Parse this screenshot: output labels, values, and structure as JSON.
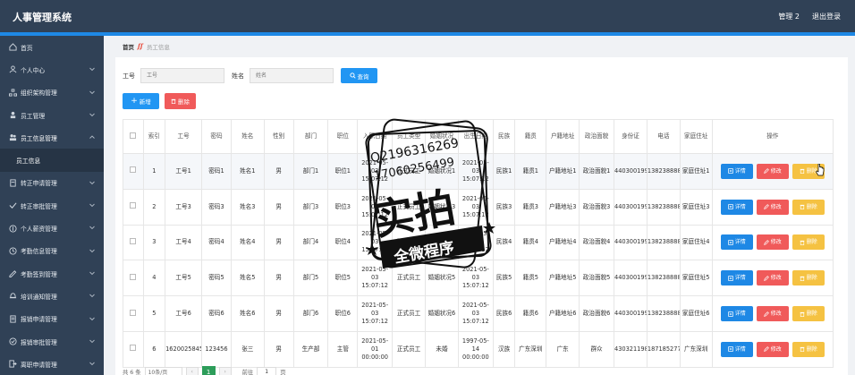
{
  "header": {
    "title": "人事管理系统",
    "user": "管理 2",
    "logout": "退出登录"
  },
  "sidebar": {
    "items": [
      {
        "label": "首页",
        "icon": "home-icon",
        "chevron": false
      },
      {
        "label": "个人中心",
        "icon": "person-icon",
        "chevron": true
      },
      {
        "label": "组织架构管理",
        "icon": "org-icon",
        "chevron": true
      },
      {
        "label": "员工管理",
        "icon": "user-icon",
        "chevron": true
      },
      {
        "label": "员工信息管理",
        "icon": "users-icon",
        "chevron": true,
        "open": true
      },
      {
        "label": "员工信息",
        "sub": true
      },
      {
        "label": "转正申请管理",
        "icon": "doc-icon",
        "chevron": true
      },
      {
        "label": "转正审批管理",
        "icon": "check-icon",
        "chevron": true
      },
      {
        "label": "个人薪资管理",
        "icon": "money-icon",
        "chevron": true
      },
      {
        "label": "考勤信息管理",
        "icon": "clock-icon",
        "chevron": true
      },
      {
        "label": "考勤签到管理",
        "icon": "sign-icon",
        "chevron": true
      },
      {
        "label": "培训通知管理",
        "icon": "bell-icon",
        "chevron": true
      },
      {
        "label": "报销申请管理",
        "icon": "receipt-icon",
        "chevron": true
      },
      {
        "label": "报销审批管理",
        "icon": "approve-icon",
        "chevron": true
      },
      {
        "label": "离职申请管理",
        "icon": "exit-icon",
        "chevron": true
      }
    ]
  },
  "breadcrumb": {
    "home": "首页",
    "sep": "ʃʃ",
    "current": "员工信息"
  },
  "search": {
    "gonghao_label": "工号",
    "gonghao_placeholder": "工号",
    "xingming_label": "姓名",
    "xingming_placeholder": "姓名",
    "query_label": "查询"
  },
  "toolbar": {
    "add_label": "新增",
    "delete_label": "删除"
  },
  "table": {
    "headers": [
      "",
      "索引",
      "工号",
      "密码",
      "姓名",
      "性别",
      "部门",
      "职位",
      "入职日期",
      "员工类型",
      "婚姻状况",
      "出生日期",
      "民族",
      "籍贯",
      "户籍地址",
      "政治面貌",
      "身份证",
      "电话",
      "家庭住址",
      "操作"
    ],
    "rows": [
      [
        "1",
        "工号1",
        "密码1",
        "姓名1",
        "男",
        "部门1",
        "职位1",
        "2021-05-03 15:07:12",
        "正式员工",
        "婚姻状况1",
        "2021-05-03 15:07:12",
        "民族1",
        "籍贯1",
        "户籍地址1",
        "政治面貌1",
        "440300199101010001",
        "13823888881",
        "家庭住址1"
      ],
      [
        "2",
        "工号3",
        "密码3",
        "姓名3",
        "男",
        "部门3",
        "职位3",
        "2021-05-03 15:07:12",
        "正式员工",
        "婚姻状况3",
        "2021-05-03 15:07:12",
        "民族3",
        "籍贯3",
        "户籍地址3",
        "政治面貌3",
        "440300199303030003",
        "13823888883",
        "家庭住址3"
      ],
      [
        "3",
        "工号4",
        "密码4",
        "姓名4",
        "男",
        "部门4",
        "职位4",
        "2021-05-03 15:07:12",
        "正式员工",
        "婚姻状况4",
        "2021-05-03 15:07:12",
        "民族4",
        "籍贯4",
        "户籍地址4",
        "政治面貌4",
        "440300199404040004",
        "13823888884",
        "家庭住址4"
      ],
      [
        "4",
        "工号5",
        "密码5",
        "姓名5",
        "男",
        "部门5",
        "职位5",
        "2021-05-03 15:07:12",
        "正式员工",
        "婚姻状况5",
        "2021-05-03 15:07:12",
        "民族5",
        "籍贯5",
        "户籍地址5",
        "政治面貌5",
        "440300199505050005",
        "13823888885",
        "家庭住址5"
      ],
      [
        "5",
        "工号6",
        "密码6",
        "姓名6",
        "男",
        "部门6",
        "职位6",
        "2021-05-03 15:07:12",
        "正式员工",
        "婚姻状况6",
        "2021-05-03 15:07:12",
        "民族6",
        "籍贯6",
        "户籍地址6",
        "政治面貌6",
        "440300199606060006",
        "13823888886",
        "家庭住址6"
      ],
      [
        "6",
        "1620025845626",
        "123456",
        "张三",
        "男",
        "生产部",
        "主管",
        "2021-05-01 00:00:00",
        "正式员工",
        "未婚",
        "1997-05-14 00:00:00",
        "汉族",
        "广东深圳",
        "广东",
        "群众",
        "430321198812121212",
        "18718527777",
        "广东深圳"
      ]
    ],
    "actions": {
      "detail": "详情",
      "edit": "修改",
      "delete": "删除"
    }
  },
  "pager": {
    "total": "共 6 条",
    "size": "10条/页",
    "prev": "‹",
    "page": "1",
    "next": "›",
    "goto": "前往",
    "goto_value": "1",
    "page_unit": "页"
  },
  "watermark": {
    "qq": "Q2196316269",
    "phone": "17060256499",
    "big": "实拍",
    "banner": "全微程序"
  },
  "colors": {
    "header": "#304156",
    "accent": "#2196f3",
    "danger": "#f05a5a",
    "warning": "#f5c242",
    "pager_active": "#2d9d5a"
  }
}
